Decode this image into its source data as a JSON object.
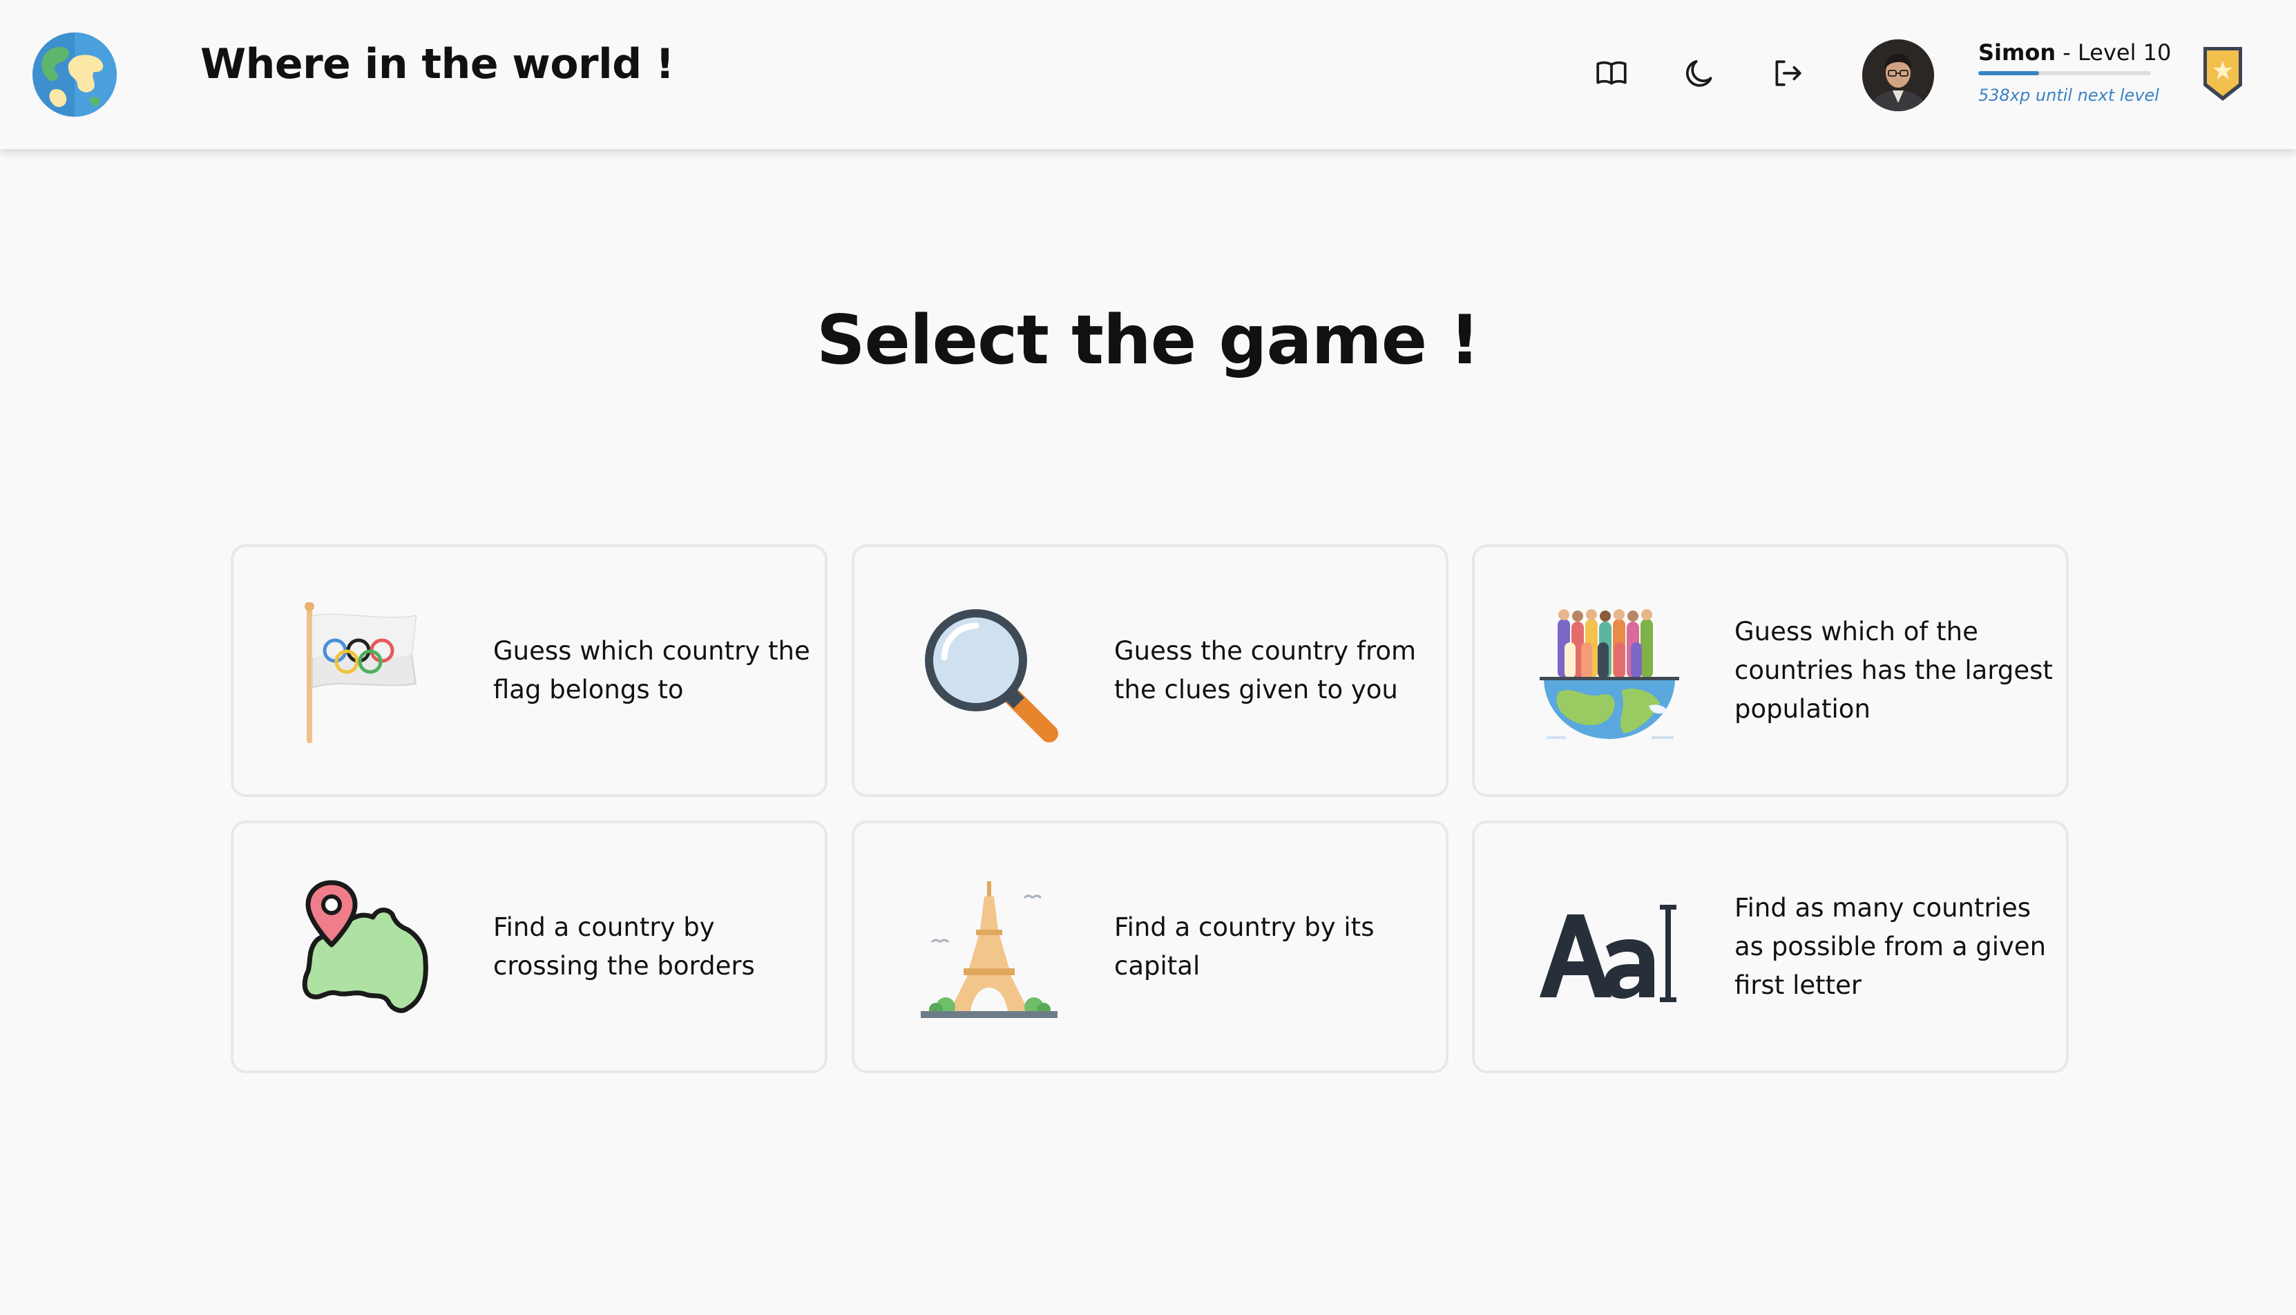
{
  "header": {
    "app_title": "Where in the world !",
    "icons": [
      "globe-logo-icon",
      "book-icon",
      "moon-icon",
      "logout-icon",
      "rank-badge-icon"
    ],
    "user": {
      "name": "Simon",
      "separator": " - ",
      "level": "Level 10",
      "xp_text": "538xp until next level",
      "xp_progress": 0.35
    }
  },
  "main": {
    "heading": "Select the game !",
    "games": [
      {
        "label": "Guess which country the flag belongs to",
        "icon": "olympic-flag-icon"
      },
      {
        "label": "Guess the country from the clues given to you",
        "icon": "magnifier-icon"
      },
      {
        "label": "Guess which of the countries has the largest population",
        "icon": "population-globe-icon"
      },
      {
        "label": "Find a country by crossing the borders",
        "icon": "map-pin-icon"
      },
      {
        "label": "Find a country by its capital",
        "icon": "eiffel-tower-icon"
      },
      {
        "label": "Find as many countries as possible from a given first letter",
        "icon": "letters-aa-icon"
      }
    ]
  },
  "colors": {
    "background": "#f9f9f9",
    "accent": "#3b82c4",
    "card_border": "#e8e8e8",
    "text": "#111111"
  }
}
